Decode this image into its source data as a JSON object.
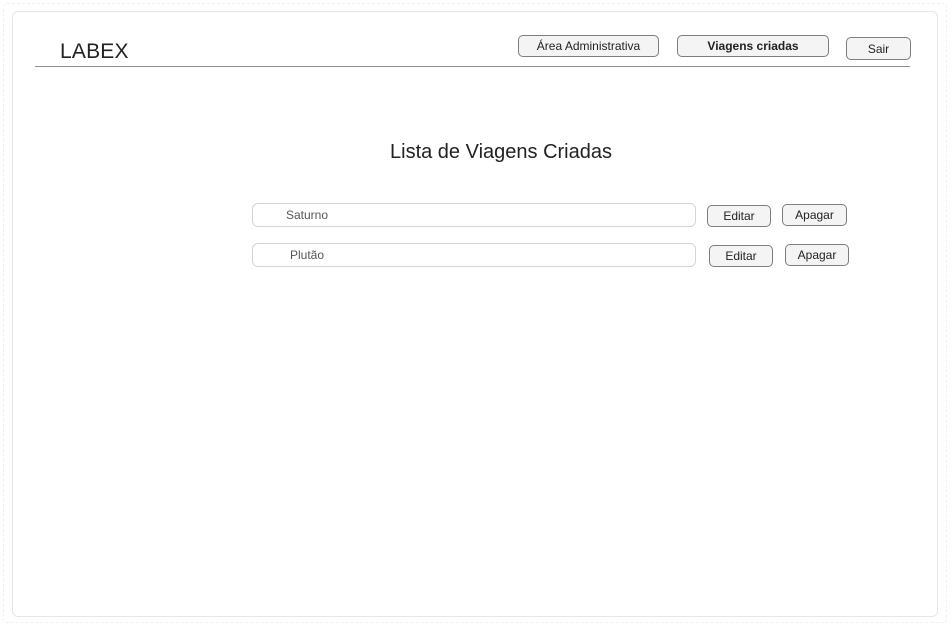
{
  "header": {
    "logo": "LABEX",
    "nav": [
      {
        "label": "Área Administrativa"
      },
      {
        "label": "Viagens criadas"
      },
      {
        "label": "Sair"
      }
    ]
  },
  "main": {
    "title": "Lista de Viagens Criadas",
    "trips": [
      {
        "name": "Saturno",
        "edit_label": "Editar",
        "delete_label": "Apagar"
      },
      {
        "name": "Plutão",
        "edit_label": "Editar",
        "delete_label": "Apagar"
      }
    ]
  }
}
